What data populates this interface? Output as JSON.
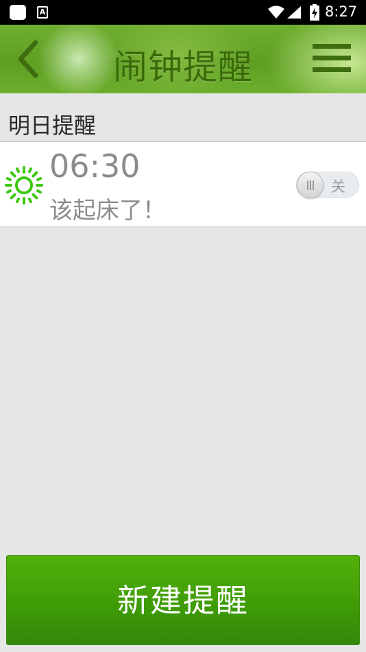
{
  "status_bar": {
    "time": "8:27",
    "icons": [
      "app-notification-icon",
      "text-a-icon",
      "wifi-icon",
      "signal-icon",
      "battery-charging-icon"
    ]
  },
  "header": {
    "title": "闹钟提醒",
    "back_icon": "chevron-left-icon",
    "menu_icon": "hamburger-menu-icon"
  },
  "section": {
    "title": "明日提醒"
  },
  "alarms": [
    {
      "icon": "sun-icon",
      "time": "06:30",
      "note": "该起床了！",
      "toggle_label": "关",
      "enabled": false
    }
  ],
  "actions": {
    "new_reminder_label": "新建提醒"
  },
  "colors": {
    "header_green": "#5e9f22",
    "title_text": "#3a6a08",
    "button_green": "#3e9a06",
    "sun_green": "#3cc80f",
    "muted_text": "#8c8c8c"
  }
}
